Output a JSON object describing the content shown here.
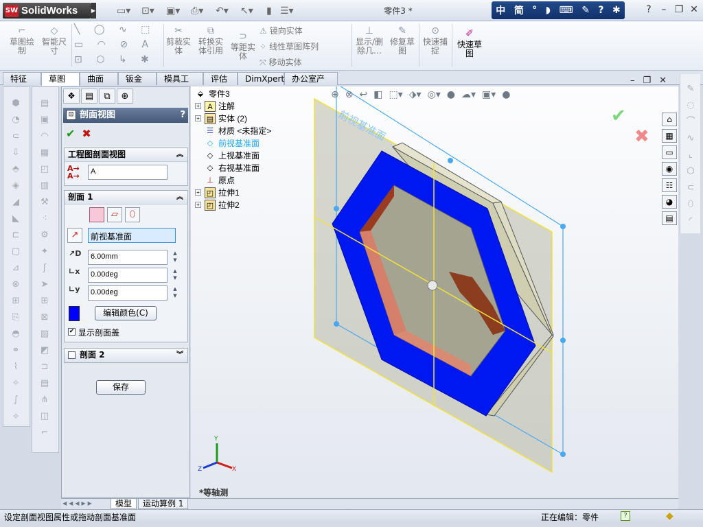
{
  "app": {
    "name": "SolidWorks",
    "logo_badge": "SW",
    "document_title": "零件3 *"
  },
  "ime_bar": {
    "items": [
      "中",
      "简",
      "°",
      "◗",
      "⌨",
      "✎",
      "?",
      "✱"
    ]
  },
  "title_buttons": {
    "help": "?",
    "minimize": "–",
    "restore": "❐",
    "close": "✕"
  },
  "ribbon": {
    "sketch": "草图绘制",
    "smart_dim": "智能尺寸",
    "trim": "剪裁实体",
    "convert": "转换实体引用",
    "offset": "等距实体",
    "mirror": "镜向实体",
    "linear_pattern": "线性草图阵列",
    "move": "移动实体",
    "display_delete": "显示/删除几…",
    "repair": "修复草图",
    "quick_snap": "快速捕捉",
    "rapid_sketch": "快速草图"
  },
  "tabs": [
    "特征",
    "草图",
    "曲面",
    "钣金",
    "模具工具",
    "评估",
    "DimXpert",
    "办公室产品"
  ],
  "active_tab_index": 1,
  "pm": {
    "title": "剖面视图",
    "help": "?",
    "group1_title": "工程图剖面视图",
    "section_name": "A",
    "group2_title": "剖面 1",
    "plane_ref": "前视基准面",
    "distance": "6.00mm",
    "angle_x": "0.00deg",
    "angle_y": "0.00deg",
    "edit_color_label": "编辑颜色(C)",
    "section_color": "#0000ff",
    "show_cap_label": "显示剖面盖",
    "show_cap_checked": true,
    "group3_title": "剖面 2",
    "save_label": "保存"
  },
  "tree": [
    {
      "label": "零件3",
      "icon": "part-icon",
      "expand": false
    },
    {
      "label": "注解",
      "icon": "annotation-icon",
      "expand": true
    },
    {
      "label": "实体 (2)",
      "icon": "solid-bodies-icon",
      "expand": true
    },
    {
      "label": "材质 <未指定>",
      "icon": "material-icon",
      "expand": false
    },
    {
      "label": "前视基准面",
      "icon": "plane-icon",
      "expand": false,
      "highlight": true
    },
    {
      "label": "上视基准面",
      "icon": "plane-icon",
      "expand": false
    },
    {
      "label": "右视基准面",
      "icon": "plane-icon",
      "expand": false
    },
    {
      "label": "原点",
      "icon": "origin-icon",
      "expand": false
    },
    {
      "label": "拉伸1",
      "icon": "extrude-icon",
      "expand": true
    },
    {
      "label": "拉伸2",
      "icon": "extrude-icon",
      "expand": true
    }
  ],
  "view": {
    "plane_label": "前视基准面",
    "orientation": "*等轴测",
    "triad": {
      "x": "X",
      "y": "Y",
      "z": "Z"
    }
  },
  "bottom_tabs": [
    "模型",
    "运动算例 1"
  ],
  "status": {
    "message": "设定剖面视图属性或拖动剖面基准面",
    "editing": "正在编辑：零件",
    "help_badge": "?"
  }
}
